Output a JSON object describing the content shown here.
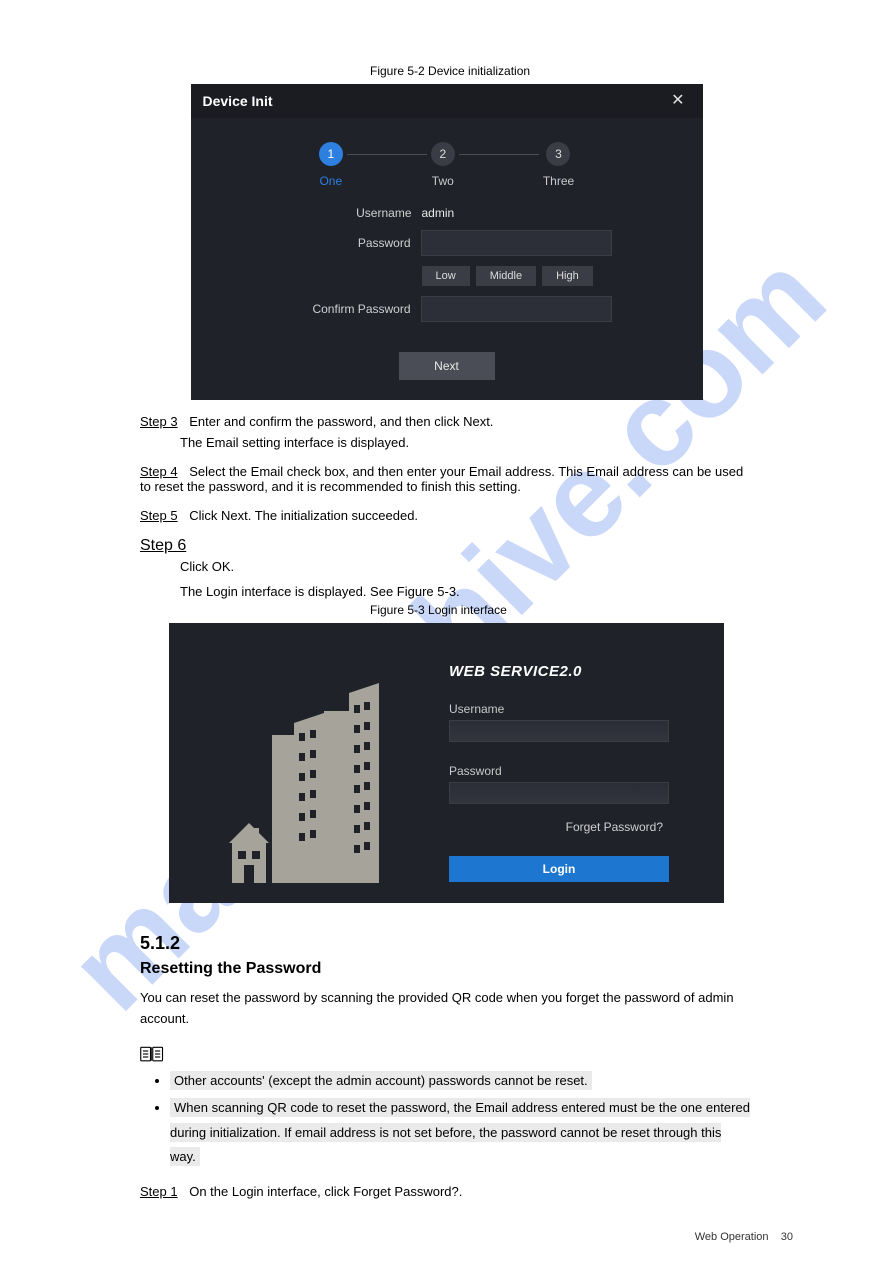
{
  "watermark": "manualshive.com",
  "figure1": {
    "caption": "Figure 5-2 Device initialization"
  },
  "dialog": {
    "title": "Device Init",
    "steps": [
      {
        "num": "1",
        "label": "One",
        "active": true
      },
      {
        "num": "2",
        "label": "Two",
        "active": false
      },
      {
        "num": "3",
        "label": "Three",
        "active": false
      }
    ],
    "username_label": "Username",
    "username_value": "admin",
    "password_label": "Password",
    "password_value": "",
    "confirm_label": "Confirm Password",
    "confirm_value": "",
    "strength": {
      "low": "Low",
      "middle": "Middle",
      "high": "High"
    },
    "next": "Next"
  },
  "steps_text": {
    "s3_lead": "Step 3",
    "s3_body": "Enter and confirm the password, and then click Next.",
    "s3_sub": "The Email setting interface is displayed.",
    "s4_lead": "Step 4",
    "s4_body": "Select the Email check box, and then enter your Email address. This Email address can be used to reset the password, and it is recommended to finish this setting.",
    "s5_lead": "Step 5",
    "s5_body": "Click Next. The initialization succeeded.",
    "s6_lead": "Step 6",
    "s6_body": "Click OK.",
    "s6_sub": "The Login interface is displayed. See Figure 5-3."
  },
  "figure2": {
    "caption": "Figure 5-3 Login interface"
  },
  "login": {
    "brand": "WEB SERVICE2.0",
    "username_label": "Username",
    "username_value": "",
    "password_label": "Password",
    "password_value": "",
    "forget": "Forget Password?",
    "login_btn": "Login"
  },
  "section": {
    "num": "5.1.2",
    "title": "Resetting the Password"
  },
  "reset_intro": "You can reset the password by scanning the provided QR code when you forget the password of admin account.",
  "notes": [
    "Other accounts' (except the admin account) passwords cannot be reset.",
    "When scanning QR code to reset the password, the Email address entered must be the one entered during initialization. If email address is not set before, the password cannot be reset through this way."
  ],
  "reset_s1_lead": "Step 1",
  "reset_s1_body": "On the Login interface, click Forget Password?.",
  "footer": {
    "label": "Web Operation",
    "page": "30"
  }
}
